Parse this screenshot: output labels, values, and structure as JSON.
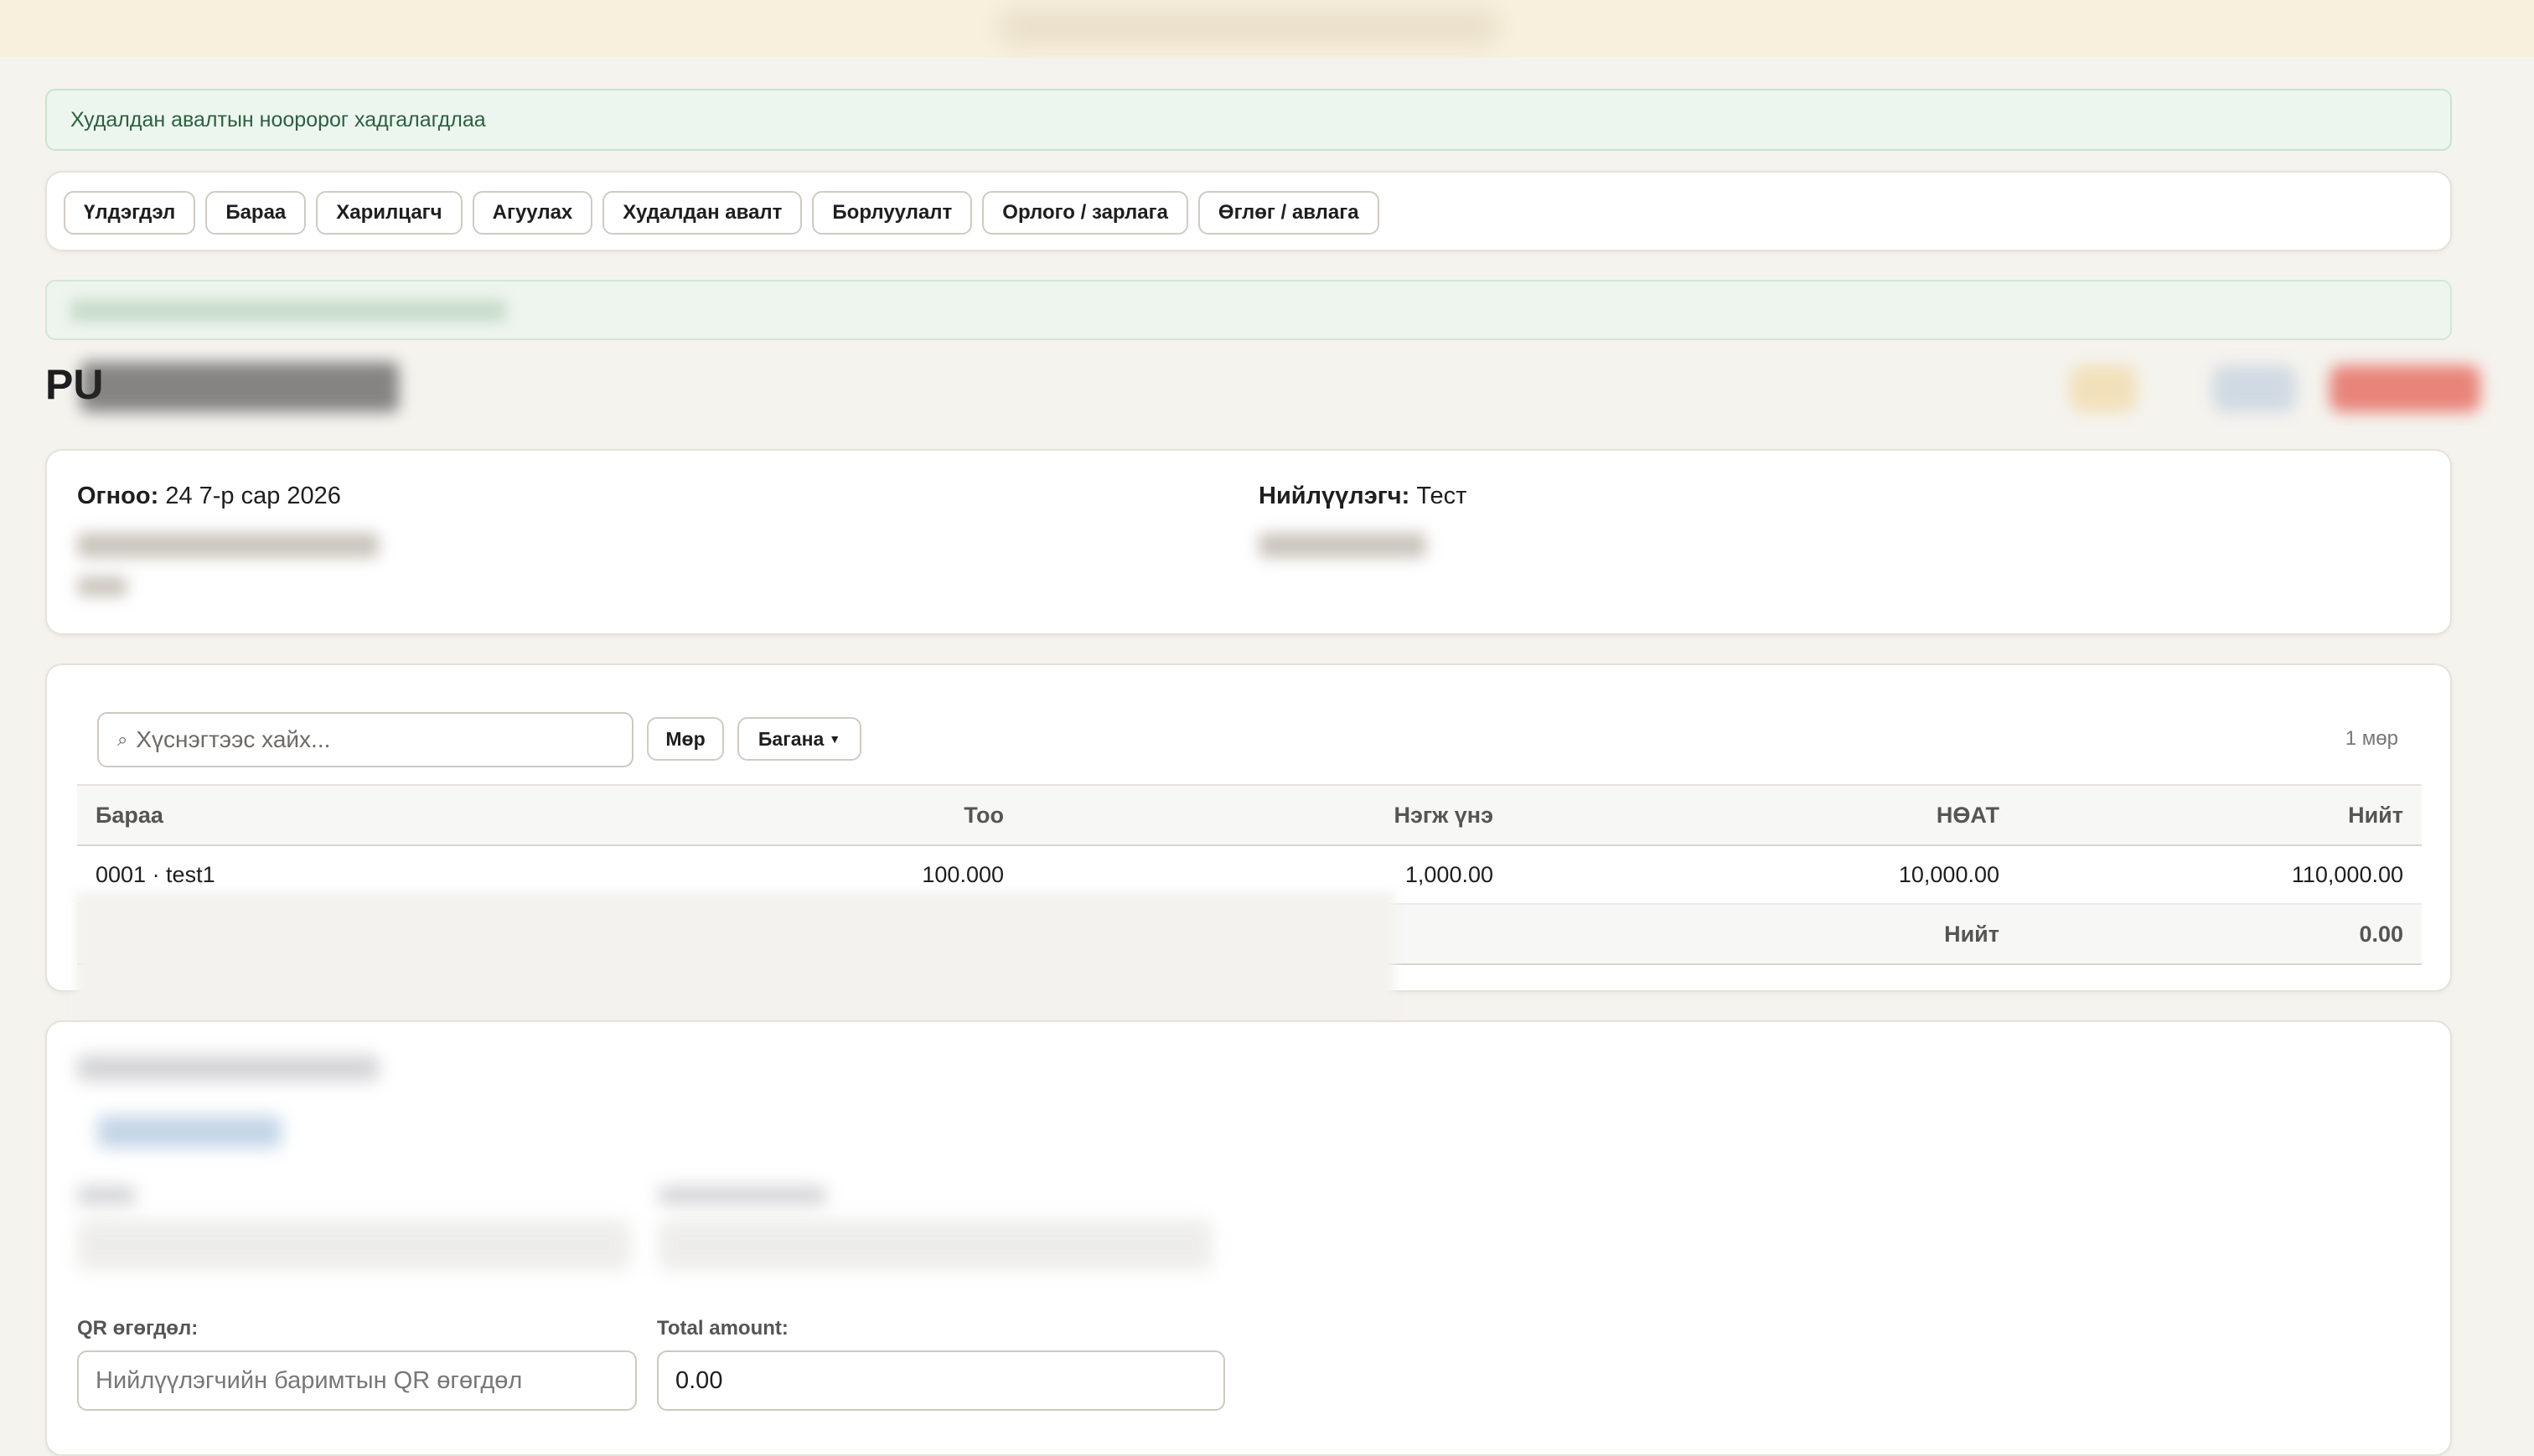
{
  "alert": {
    "message": "Худалдан авалтын нооророг хадгалагдлаа"
  },
  "nav": {
    "items": [
      {
        "label": "Үлдэгдэл"
      },
      {
        "label": "Бараа"
      },
      {
        "label": "Харилцагч"
      },
      {
        "label": "Агуулах"
      },
      {
        "label": "Худалдан авалт"
      },
      {
        "label": "Борлуулалт"
      },
      {
        "label": "Орлого / зарлага"
      },
      {
        "label": "Өглөг / авлага"
      }
    ]
  },
  "page": {
    "title_visible": "PU"
  },
  "info": {
    "date_label": "Огноо:",
    "date_value": "24 7-р сар 2026",
    "supplier_label": "Нийлүүлэгч:",
    "supplier_value": "Тест"
  },
  "items_table": {
    "search_placeholder": "Хүснэгтээс хайх...",
    "search_icon": "search-icon",
    "row_button": "Мөр",
    "column_button": "Багана",
    "row_count": "1 мөр",
    "columns": [
      "Бараа",
      "Тоо",
      "Нэгж үнэ",
      "НӨАТ",
      "Нийт"
    ],
    "rows": [
      {
        "item": "0001 · test1",
        "qty": "100.000",
        "unit_price": "1,000.00",
        "vat": "10,000.00",
        "total": "110,000.00"
      }
    ],
    "footer": {
      "label": "Нийт",
      "value": "0.00"
    }
  },
  "payment": {
    "qr_label": "QR өгөгдөл:",
    "qr_placeholder": "Нийлүүлэгчийн баримтын QR өгөгдөл",
    "total_label": "Total amount:",
    "total_value": "0.00"
  },
  "colors": {
    "background": "#f5f3ee",
    "topbar": "#f8f0dd",
    "alert_bg": "#ecf6ef",
    "alert_text": "#2d5f3e",
    "danger_button": "#e8847a"
  }
}
